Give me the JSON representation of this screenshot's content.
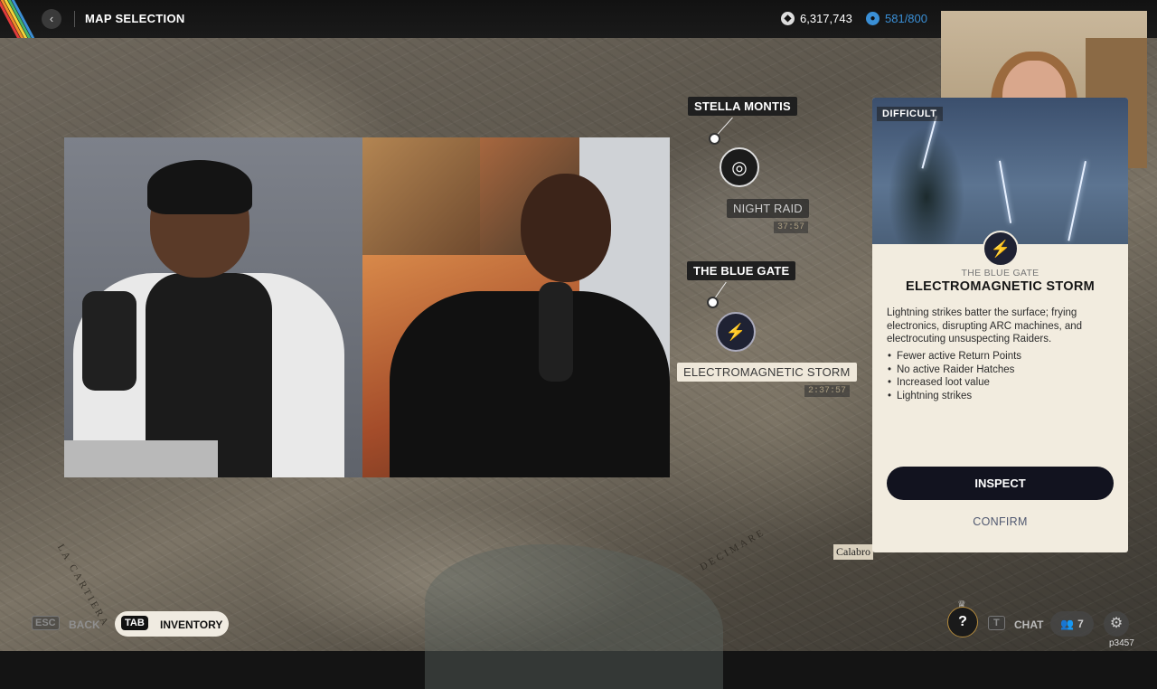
{
  "topbar": {
    "title": "MAP SELECTION",
    "back_icon": "chevron-left",
    "currency_1": {
      "icon": "coin-icon",
      "value": "6,317,743"
    },
    "currency_2": {
      "icon": "capacity-icon",
      "value": "581/800",
      "color": "#3a8fd6"
    }
  },
  "map": {
    "labels": {
      "stella_montis": "STELLA MONTIS",
      "decimare": "DECIMARE",
      "la_cartiera": "LA CARTIERA",
      "calabria": "Calabro"
    }
  },
  "locations": [
    {
      "name": "STELLA MONTIS",
      "condition": "NIGHT RAID",
      "timer": "37:57",
      "icon": "night-raid-icon"
    },
    {
      "name": "THE BLUE GATE",
      "condition": "ELECTROMAGNETIC STORM",
      "timer": "2:37:57",
      "icon": "lightning-icon"
    }
  ],
  "panel": {
    "difficulty_label": "DIFFICULT",
    "location": "THE BLUE GATE",
    "title": "ELECTROMAGNETIC STORM",
    "description": "Lightning strikes batter the surface; frying electronics, disrupting ARC machines, and electrocuting unsuspecting Raiders.",
    "effects": [
      "Fewer active Return Points",
      "No active Raider Hatches",
      "Increased loot value",
      "Lightning strikes"
    ],
    "inspect_label": "INSPECT",
    "confirm_label": "CONFIRM",
    "accent": "#12131f"
  },
  "bottombar": {
    "esc_key": "ESC",
    "back_label": "BACK",
    "tab_key": "TAB",
    "inventory_label": "INVENTORY",
    "help_label": "?",
    "chat_key": "T",
    "chat_label": "CHAT",
    "party_count": "7",
    "watermark": "p3457"
  }
}
